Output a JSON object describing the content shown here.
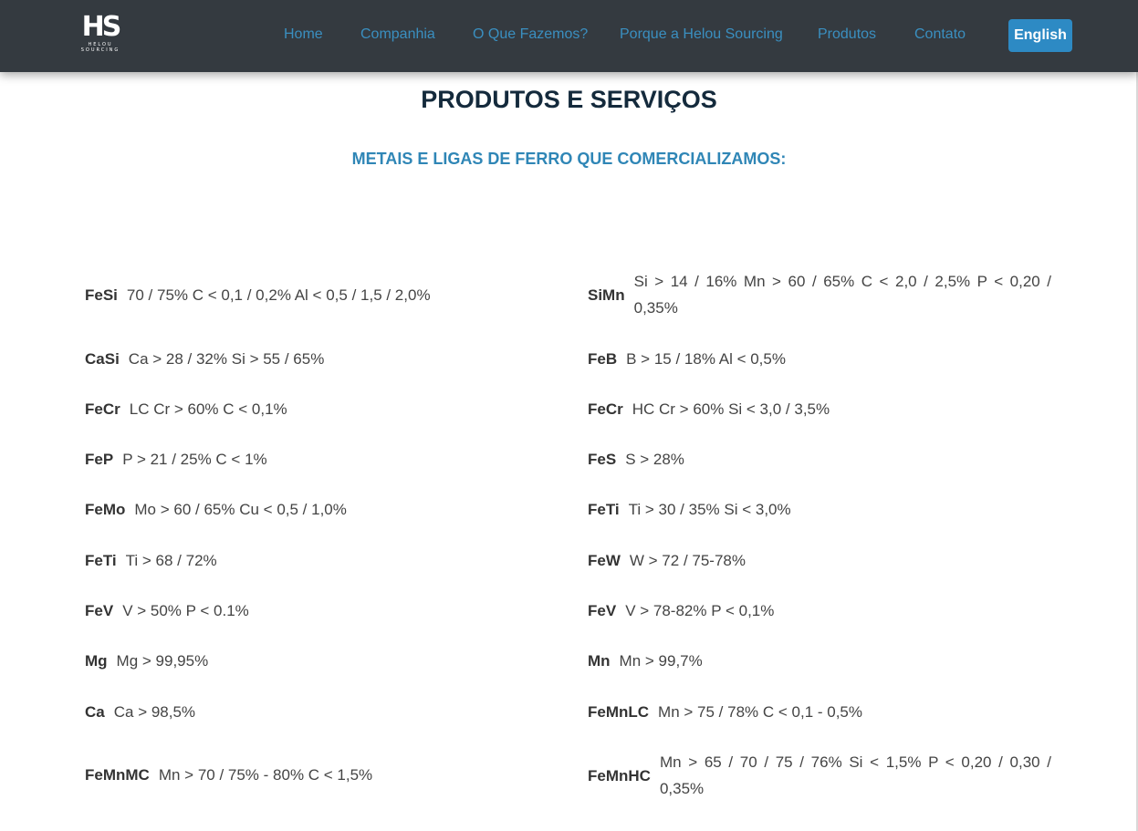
{
  "header": {
    "logo": {
      "mark": "HS",
      "sub": "HELOU SOURCING"
    },
    "nav": [
      {
        "label": "Home"
      },
      {
        "label": "Companhia"
      },
      {
        "label": "O Que Fazemos?"
      },
      {
        "label": "Porque a Helou Sourcing"
      },
      {
        "label": "Produtos"
      },
      {
        "label": "Contato"
      }
    ],
    "language_button": "English"
  },
  "main": {
    "title": "PRODUTOS E SERVIÇOS",
    "subtitle": "METAIS E LIGAS DE FERRO QUE COMERCIALIZAMOS:",
    "left": [
      {
        "code": "FeSi",
        "desc": "70 / 75% C < 0,1 / 0,2% Al < 0,5 / 1,5 / 2,0%"
      },
      {
        "code": "CaSi",
        "desc": "Ca > 28 / 32% Si > 55 / 65%"
      },
      {
        "code": "FeCr",
        "desc": "LC Cr > 60% C < 0,1%"
      },
      {
        "code": "FeP",
        "desc": "P > 21 / 25% C < 1%"
      },
      {
        "code": "FeMo",
        "desc": "Mo > 60 / 65% Cu < 0,5 / 1,0%"
      },
      {
        "code": "FeTi",
        "desc": "Ti > 68 / 72%"
      },
      {
        "code": "FeV",
        "desc": "V > 50% P < 0.1%"
      },
      {
        "code": "Mg",
        "desc": "Mg > 99,95%"
      },
      {
        "code": "Ca",
        "desc": "Ca > 98,5%"
      },
      {
        "code": "FeMnMC",
        "desc": "Mn > 70 / 75% - 80% C < 1,5%"
      }
    ],
    "right": [
      {
        "code": "SiMn",
        "desc": "Si > 14 / 16% Mn > 60 / 65% C < 2,0 / 2,5% P < 0,20 / 0,35%"
      },
      {
        "code": "FeB",
        "desc": "B > 15 / 18% Al < 0,5%"
      },
      {
        "code": "FeCr",
        "desc": "HC Cr > 60% Si < 3,0 / 3,5%"
      },
      {
        "code": "FeS",
        "desc": "S > 28%"
      },
      {
        "code": "FeTi",
        "desc": "Ti > 30 / 35% Si < 3,0%"
      },
      {
        "code": "FeW",
        "desc": "W > 72 / 75-78%"
      },
      {
        "code": "FeV",
        "desc": "V > 78-82% P < 0,1%"
      },
      {
        "code": "Mn",
        "desc": "Mn > 99,7%"
      },
      {
        "code": "FeMnLC",
        "desc": "Mn > 75 / 78% C < 0,1 - 0,5%"
      },
      {
        "code": "FeMnHC",
        "desc": "Mn > 65 / 70 / 75 / 76% Si < 1,5% P < 0,20 / 0,30 / 0,35%"
      }
    ]
  }
}
